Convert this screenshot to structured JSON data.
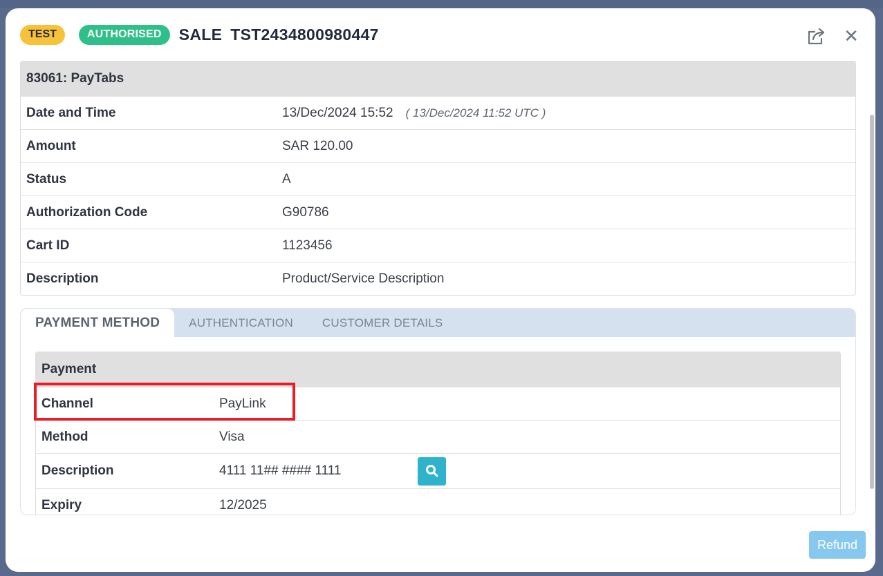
{
  "header": {
    "badge_test": "TEST",
    "badge_status": "AUTHORISED",
    "title_type": "SALE",
    "title_ref": "TST2434800980447",
    "close_glyph": "✕",
    "share_icon": "share-icon",
    "close_icon": "close-icon"
  },
  "info": {
    "heading": "83061: PayTabs",
    "rows": [
      {
        "label": "Date and Time",
        "value": "13/Dec/2024 15:52",
        "extra": "( 13/Dec/2024 11:52 UTC )"
      },
      {
        "label": "Amount",
        "value": "SAR 120.00"
      },
      {
        "label": "Status",
        "value": "A"
      },
      {
        "label": "Authorization Code",
        "value": "G90786"
      },
      {
        "label": "Cart ID",
        "value": "1123456"
      },
      {
        "label": "Description",
        "value": "Product/Service Description"
      }
    ]
  },
  "tabs": [
    {
      "label": "PAYMENT METHOD",
      "active": true
    },
    {
      "label": "AUTHENTICATION",
      "active": false
    },
    {
      "label": "CUSTOMER DETAILS",
      "active": false
    }
  ],
  "payment": {
    "heading": "Payment",
    "rows": [
      {
        "label": "Channel",
        "value": "PayLink"
      },
      {
        "label": "Method",
        "value": "Visa"
      },
      {
        "label": "Description",
        "value": "4111 11## #### 1111"
      },
      {
        "label": "Expiry",
        "value": "12/2025"
      }
    ]
  },
  "footer": {
    "refund_label": "Refund"
  },
  "colors": {
    "test_badge": "#f5c23a",
    "authorised_badge": "#2fbf8a",
    "highlight": "#ec1c24",
    "search_button": "#2fb3cc",
    "refund_button": "#86c8ef"
  }
}
